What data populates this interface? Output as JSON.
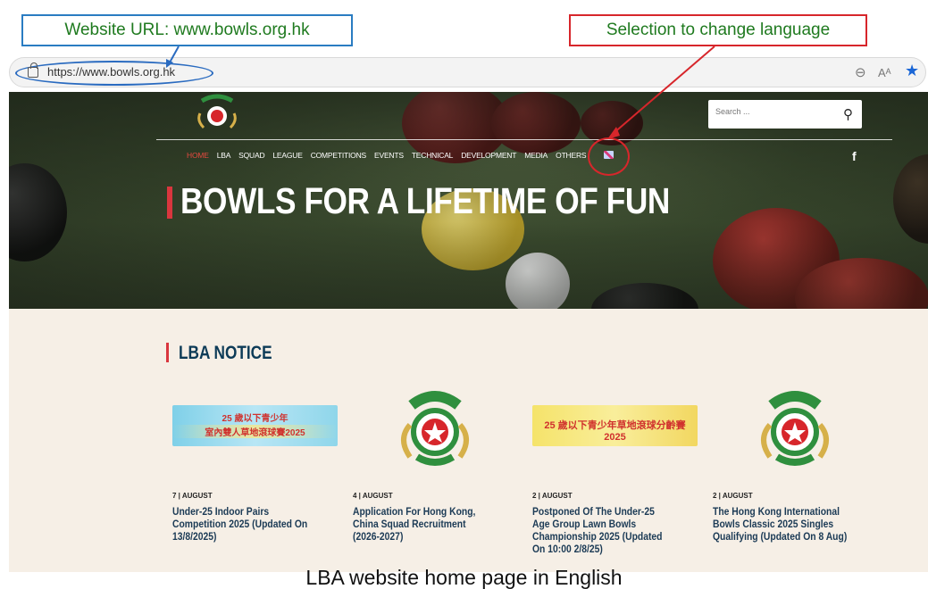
{
  "callouts": {
    "url": "Website URL: www.bowls.org.hk",
    "language": "Selection to change language"
  },
  "browser": {
    "url": "https://www.bowls.org.hk",
    "icons": [
      "lock-icon",
      "zoom-icon",
      "read-aloud-icon",
      "favorite-star-icon"
    ]
  },
  "site": {
    "search_placeholder": "Search ...",
    "nav": [
      "HOME",
      "LBA",
      "SQUAD",
      "LEAGUE",
      "COMPETITIONS",
      "EVENTS",
      "TECHNICAL",
      "DEVELOPMENT",
      "MEDIA",
      "OTHERS"
    ],
    "active_nav": "HOME",
    "hero_title": "BOWLS FOR A LIFETIME OF FUN",
    "notice_title": "LBA NOTICE",
    "cards": [
      {
        "image": "banner",
        "banner_line1": "25 歲以下青少年",
        "banner_line2": "室內雙人草地滾球賽2025",
        "date": "7 | AUGUST",
        "title": "Under-25 Indoor Pairs Competition 2025 (Updated On 13/8/2025)"
      },
      {
        "image": "emblem",
        "date": "4 | AUGUST",
        "title": "Application For Hong Kong, China Squad Recruitment (2026-2027)"
      },
      {
        "image": "banner",
        "banner_line1": "25 歲以下青少年草地滾球分齡賽 2025",
        "date": "2 | AUGUST",
        "title": "Postponed Of The Under-25 Age Group Lawn Bowls Championship 2025 (Updated On 10:00 2/8/25)"
      },
      {
        "image": "emblem",
        "date": "2 | AUGUST",
        "title": "The Hong Kong International Bowls Classic 2025 Singles Qualifying (Updated On 8 Aug)"
      }
    ]
  },
  "caption": "LBA website home page in English",
  "colors": {
    "accent_red": "#d9363e",
    "callout_green": "#1f7a1f",
    "callout_blue_border": "#2a7cc2",
    "callout_red_border": "#d7262b",
    "notice_bg": "#f6efe6",
    "title_navy": "#0d3b57"
  }
}
